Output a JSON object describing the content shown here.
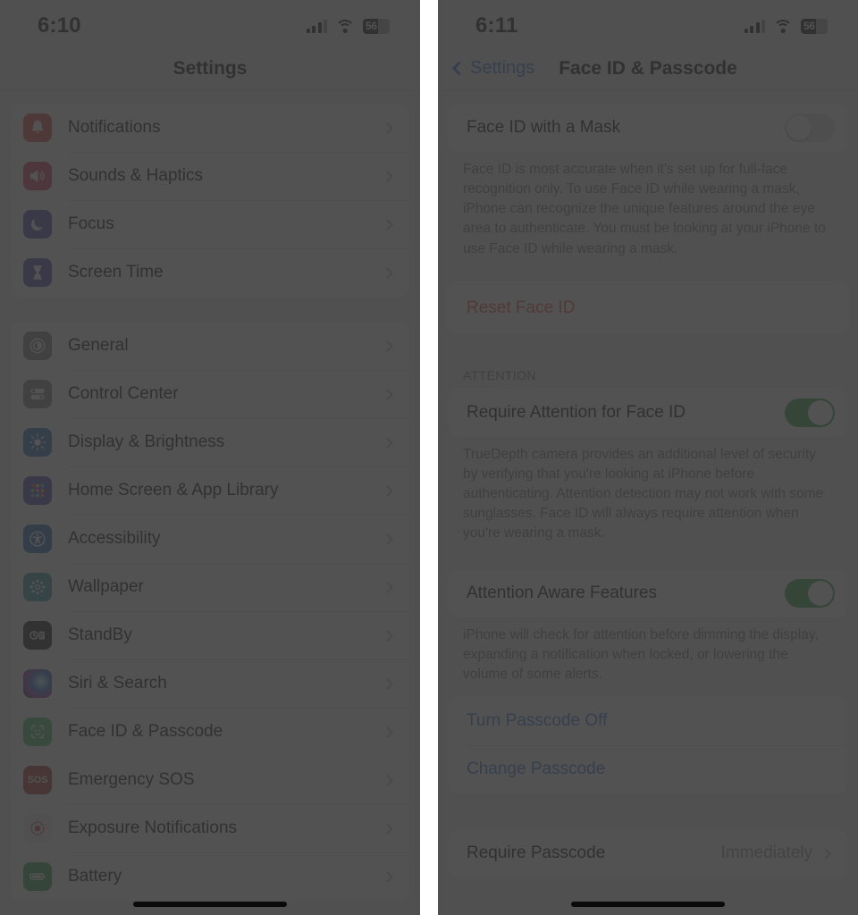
{
  "left_panel": {
    "status_bar": {
      "time": "6:10",
      "battery_percent": "56",
      "cellular_icon": "cellular-bars-icon",
      "wifi_icon": "wifi-icon",
      "battery_icon": "battery-icon"
    },
    "nav": {
      "title": "Settings"
    },
    "group_1": [
      {
        "label": "Notifications",
        "icon": "bell-icon",
        "icon_class": "ic-bell"
      },
      {
        "label": "Sounds & Haptics",
        "icon": "speaker-icon",
        "icon_class": "ic-sound"
      },
      {
        "label": "Focus",
        "icon": "moon-icon",
        "icon_class": "ic-focus"
      },
      {
        "label": "Screen Time",
        "icon": "hourglass-icon",
        "icon_class": "ic-screentime"
      }
    ],
    "group_2": [
      {
        "label": "General",
        "icon": "gear-icon",
        "icon_class": "ic-general"
      },
      {
        "label": "Control Center",
        "icon": "sliders-icon",
        "icon_class": "ic-control"
      },
      {
        "label": "Display & Brightness",
        "icon": "brightness-icon",
        "icon_class": "ic-display"
      },
      {
        "label": "Home Screen & App Library",
        "icon": "app-grid-icon",
        "icon_class": "ic-home"
      },
      {
        "label": "Accessibility",
        "icon": "accessibility-icon",
        "icon_class": "ic-access"
      },
      {
        "label": "Wallpaper",
        "icon": "flower-icon",
        "icon_class": "ic-wallpaper"
      },
      {
        "label": "StandBy",
        "icon": "standby-clock-icon",
        "icon_class": "ic-standby"
      },
      {
        "label": "Siri & Search",
        "icon": "siri-orb-icon",
        "icon_class": "ic-siri"
      },
      {
        "label": "Face ID & Passcode",
        "icon": "face-id-icon",
        "icon_class": "ic-faceid",
        "highlighted": true
      },
      {
        "label": "Emergency SOS",
        "icon": "sos-icon",
        "icon_class": "ic-sos"
      },
      {
        "label": "Exposure Notifications",
        "icon": "exposure-icon",
        "icon_class": "ic-exposure"
      },
      {
        "label": "Battery",
        "icon": "battery-icon",
        "icon_class": "ic-battery"
      }
    ]
  },
  "right_panel": {
    "status_bar": {
      "time": "6:11",
      "battery_percent": "56",
      "cellular_icon": "cellular-bars-icon",
      "wifi_icon": "wifi-icon",
      "battery_icon": "battery-icon"
    },
    "nav": {
      "back_label": "Settings",
      "back_icon": "chevron-left-icon",
      "title": "Face ID & Passcode"
    },
    "mask_row": {
      "label": "Face ID with a Mask",
      "toggle_state": "off"
    },
    "mask_footer": "Face ID is most accurate when it's set up for full-face recognition only. To use Face ID while wearing a mask, iPhone can recognize the unique features around the eye area to authenticate. You must be looking at your iPhone to use Face ID while wearing a mask.",
    "reset_row": {
      "label": "Reset Face ID",
      "highlighted": true
    },
    "attention_header": "ATTENTION",
    "attention_rows": [
      {
        "label": "Require Attention for Face ID",
        "toggle_state": "on"
      }
    ],
    "attention_footer": "TrueDepth camera provides an additional level of security by verifying that you're looking at iPhone before authenticating. Attention detection may not work with some sunglasses. Face ID will always require attention when you're wearing a mask.",
    "aware_rows": [
      {
        "label": "Attention Aware Features",
        "toggle_state": "on"
      }
    ],
    "aware_footer": "iPhone will check for attention before dimming the display, expanding a notification when locked, or lowering the volume of some alerts.",
    "passcode_links": [
      {
        "label": "Turn Passcode Off"
      },
      {
        "label": "Change Passcode"
      }
    ],
    "require_passcode": {
      "label": "Require Passcode",
      "value": "Immediately",
      "chevron": "chevron-right-icon"
    }
  },
  "colors": {
    "accent_blue": "#2e6fd9",
    "destructive_red": "#ef3b30",
    "toggle_on_green": "#23a33f",
    "faceid_green": "#2fc25b",
    "dim_overlay": "#4a4a4a"
  }
}
